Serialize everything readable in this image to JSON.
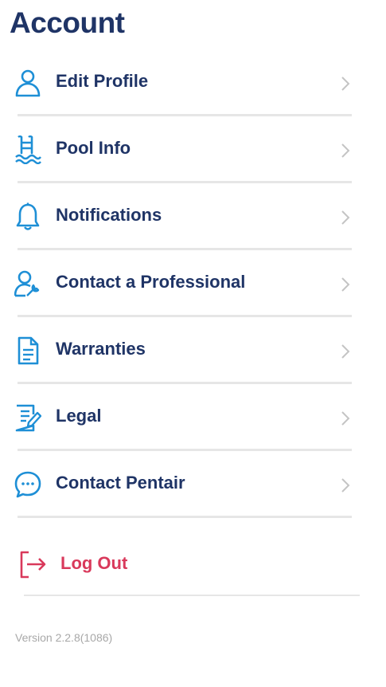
{
  "page": {
    "title": "Account",
    "version": "Version 2.2.8(1086)"
  },
  "menu": {
    "items": [
      {
        "label": "Edit Profile",
        "icon": "user-icon"
      },
      {
        "label": "Pool Info",
        "icon": "pool-ladder-icon"
      },
      {
        "label": "Notifications",
        "icon": "bell-icon"
      },
      {
        "label": "Contact a Professional",
        "icon": "technician-icon"
      },
      {
        "label": "Warranties",
        "icon": "document-icon"
      },
      {
        "label": "Legal",
        "icon": "legal-document-icon"
      },
      {
        "label": "Contact Pentair",
        "icon": "chat-bubble-icon"
      }
    ],
    "logout_label": "Log Out",
    "logout_icon": "logout-icon"
  },
  "colors": {
    "heading": "#1f3466",
    "icon": "#1e8fd6",
    "logout": "#d9395b",
    "chevron": "#c4c4c4",
    "divider": "#e6e6e6"
  }
}
